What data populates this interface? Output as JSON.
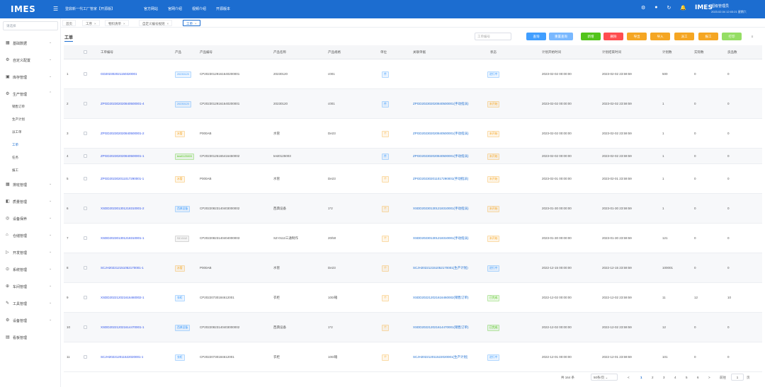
{
  "topbar": {
    "logo": "IMES",
    "app_title": "登鼎新一代工厂管家【开源版】",
    "nav": [
      "官方网站",
      "官网介绍",
      "视频介绍",
      "开源版本"
    ],
    "user_logo": "IMES",
    "user_name": "超级管理员",
    "user_time": "2023.02.04 12:03:21 星期六"
  },
  "sidebar": {
    "search_placeholder": "请选择",
    "items": [
      {
        "label": "基础数据",
        "icon": "database-icon"
      },
      {
        "label": "自定义配置",
        "icon": "settings-icon"
      },
      {
        "label": "库存管理",
        "icon": "inventory-icon"
      },
      {
        "label": "生产管理",
        "icon": "production-icon"
      },
      {
        "label": "排班管理",
        "icon": "grid-icon"
      },
      {
        "label": "质量管理",
        "icon": "quality-icon"
      },
      {
        "label": "设备保养",
        "icon": "equipment-icon"
      },
      {
        "label": "仓储管理",
        "icon": "warehouse-icon"
      },
      {
        "label": "开发管理",
        "icon": "dev-icon"
      },
      {
        "label": "系统管理",
        "icon": "system-icon"
      },
      {
        "label": "车间管理",
        "icon": "workshop-icon"
      },
      {
        "label": "工具管理",
        "icon": "tool-icon"
      },
      {
        "label": "设备管理",
        "icon": "device-icon"
      },
      {
        "label": "看板管理",
        "icon": "dashboard-icon"
      }
    ],
    "sub_items": [
      "销售订单",
      "生产计划",
      "派工单",
      "工单",
      "任务",
      "报工"
    ]
  },
  "tabs": [
    {
      "label": "首页"
    },
    {
      "label": "工序"
    },
    {
      "label": "物料清单"
    },
    {
      "label": "自定义编号规则"
    },
    {
      "label": "工单"
    }
  ],
  "header": {
    "title": "工单",
    "order_placeholder": "工单编号",
    "buttons": [
      {
        "label": "查询",
        "color": "#409eff"
      },
      {
        "label": "重置查询",
        "color": "#79b8ff"
      },
      {
        "label": "新增",
        "color": "#52c41a"
      },
      {
        "label": "删除",
        "color": "#ff4d4f"
      },
      {
        "label": "导出",
        "color": "#f5a623"
      },
      {
        "label": "导入",
        "color": "#f5a623"
      },
      {
        "label": "派工",
        "color": "#f5a623"
      },
      {
        "label": "报工",
        "color": "#f5a623"
      },
      {
        "label": "打印",
        "color": "#95de64"
      }
    ]
  },
  "table": {
    "columns": [
      "工单编号",
      "产品",
      "产品编号",
      "产品名称",
      "产品规格",
      "单位",
      "关联单据",
      "状态",
      "计划开始时间",
      "计划结束时间",
      "计划数",
      "实际数",
      "良品数"
    ],
    "rows": [
      {
        "no": "1",
        "order": "GD202302021150320001",
        "product_tag": "20230120",
        "product_tag_color": "#409eff",
        "code": "CP20230129161640200001",
        "name": "20230120",
        "spec": "c001",
        "unit": "件",
        "rel": "",
        "status": "进行中",
        "status_color": "#409eff",
        "start": "2023-02-02 00:00:00",
        "end": "2023-02-02 23:59:59",
        "plan": "500",
        "actual": "0",
        "good": "0"
      },
      {
        "no": "2",
        "order": "ZPGD202302020840500001-4",
        "product_tag": "20230120",
        "product_tag_color": "#409eff",
        "code": "CP20230129161640200001",
        "name": "20230120",
        "spec": "c001",
        "unit": "件",
        "rel": "ZPGD202302020840500001(手动指派)",
        "status": "未开始",
        "status_color": "#f5a623",
        "start": "2023-02-02 00:00:00",
        "end": "2023-02-02 23:59:59",
        "plan": "1",
        "actual": "0",
        "good": "0"
      },
      {
        "no": "3",
        "order": "ZPGD202302020840500001-2",
        "product_tag": "水管",
        "product_tag_color": "#f5a623",
        "code": "P000AB",
        "name": "水管",
        "spec": "De23",
        "unit": "个",
        "rel": "ZPGD202302020840500001(手动指派)",
        "status": "未开始",
        "status_color": "#f5a623",
        "start": "2023-02-02 00:00:00",
        "end": "2023-02-02 23:59:59",
        "plan": "1",
        "actual": "0",
        "good": "0"
      },
      {
        "no": "4",
        "order": "ZPGD202302020840500001-1",
        "product_tag": "test0125003",
        "product_tag_color": "#52c41a",
        "code": "CP20230125165416450002",
        "name": "test0125003",
        "spec": "",
        "unit": "件",
        "rel": "ZPGD202302020840500001(手动指派)",
        "status": "未开始",
        "status_color": "#f5a623",
        "start": "2023-02-02 00:00:00",
        "end": "2023-02-02 23:59:59",
        "plan": "1",
        "actual": "0",
        "good": "0"
      },
      {
        "no": "5",
        "order": "ZPGD202302011017290001-1",
        "product_tag": "水管",
        "product_tag_color": "#f5a623",
        "code": "P000AB",
        "name": "水管",
        "spec": "De23",
        "unit": "个",
        "rel": "ZPGD202302011017290001(手动指派)",
        "status": "未开始",
        "status_color": "#f5a623",
        "start": "2023-02-01 00:00:00",
        "end": "2023-02-01 23:59:59",
        "plan": "1",
        "actual": "0",
        "good": "0"
      },
      {
        "no": "6",
        "order": "XSDD202301301218310001-2",
        "product_tag": "西典设备",
        "product_tag_color": "#409eff",
        "code": "CP20220823140403000002",
        "name": "西典设备",
        "spec": "1*2",
        "unit": "个",
        "rel": "XSDD202301301218310001(手动指派)",
        "status": "未开始",
        "status_color": "#f5a623",
        "start": "2023-01-30 00:00:00",
        "end": "2023-01-30 23:59:59",
        "plan": "1",
        "actual": "0",
        "good": "0"
      },
      {
        "no": "7",
        "order": "XSDD202301301218310001-1",
        "product_tag": "SZ-0112",
        "product_tag_color": "#999999",
        "code": "CP20220823140404000003",
        "name": "SZ-0112三通制作",
        "spec": "20/50",
        "unit": "个",
        "rel": "XSDD202301301218310001(手动指派)",
        "status": "未开始",
        "status_color": "#f5a623",
        "start": "2023-01-30 00:00:00",
        "end": "2023-01-30 23:59:59",
        "plan": "121",
        "actual": "0",
        "good": "0"
      },
      {
        "no": "8",
        "order": "SCJH202212151052170001-1",
        "product_tag": "水管",
        "product_tag_color": "#f5a623",
        "code": "P000AB",
        "name": "水管",
        "spec": "De23",
        "unit": "个",
        "rel": "SCJH202212151052170001(生产计划)",
        "status": "进行中",
        "status_color": "#409eff",
        "start": "2022-12-15 00:00:00",
        "end": "2022-12-15 23:59:59",
        "plan": "100001",
        "actual": "0",
        "good": "0"
      },
      {
        "no": "9",
        "order": "XSDD202212021616460002-1",
        "product_tag": "衣柜",
        "product_tag_color": "#409eff",
        "code": "CP20220730184612001",
        "name": "衣柜",
        "spec": "100/箱",
        "unit": "个",
        "rel": "XSDD202212021616460002(销售订单)",
        "status": "已完成",
        "status_color": "#52c41a",
        "start": "2022-12-02 00:00:00",
        "end": "2022-12-02 23:59:59",
        "plan": "11",
        "actual": "12",
        "good": "10"
      },
      {
        "no": "10",
        "order": "XSDD202212021614470001-1",
        "product_tag": "西典设备",
        "product_tag_color": "#409eff",
        "code": "CP20220823140403000002",
        "name": "西典设备",
        "spec": "1*2",
        "unit": "个",
        "rel": "XSDD202212021614470001(销售订单)",
        "status": "已完成",
        "status_color": "#52c41a",
        "start": "2022-12-02 00:00:00",
        "end": "2022-12-02 23:59:59",
        "plan": "12",
        "actual": "0",
        "good": "0"
      },
      {
        "no": "11",
        "order": "SCJH202212011522020001-1",
        "product_tag": "衣柜",
        "product_tag_color": "#409eff",
        "code": "CP20220730184612001",
        "name": "衣柜",
        "spec": "100/箱",
        "unit": "个",
        "rel": "SCJH202212011522020001(生产计划)",
        "status": "进行中",
        "status_color": "#409eff",
        "start": "2022-12-01 00:00:00",
        "end": "2022-12-01 23:59:59",
        "plan": "101",
        "actual": "0",
        "good": "0"
      }
    ]
  },
  "pager": {
    "total": "共 164 条",
    "page_size": "50条/页",
    "prev": "<",
    "pages": [
      "1",
      "2",
      "3",
      "4",
      "5",
      "6"
    ],
    "next": ">",
    "goto_label": "前往",
    "goto_value": "1",
    "goto_suffix": "页"
  },
  "colors": {
    "primary": "#1c6dd0",
    "link": "#2f54eb"
  }
}
